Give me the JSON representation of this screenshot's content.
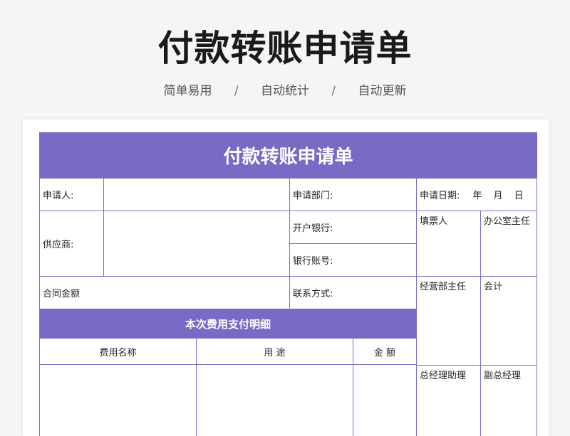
{
  "header": {
    "title": "付款转账申请单",
    "tags": [
      "简单易用",
      "自动统计",
      "自动更新"
    ],
    "separator": "/"
  },
  "form": {
    "title": "付款转账申请单",
    "applicant_label": "申请人:",
    "department_label": "申请部门:",
    "date_label": "申请日期:",
    "date_ymd": "年 月 日",
    "supplier_label": "供应商:",
    "bank_label": "开户银行:",
    "account_label": "银行账号:",
    "contract_amount_label": "合同金额",
    "contact_label": "联系方式:",
    "detail_section": "本次费用支付明细",
    "col_name": "费用名称",
    "col_usage": "用 途",
    "col_amount": "金 额",
    "sign_filler": "填票人",
    "sign_office": "办公室主任",
    "sign_ops": "经营部主任",
    "sign_accounting": "会计",
    "sign_gm_assistant": "总经理助理",
    "sign_deputy_gm": "副总经理"
  }
}
